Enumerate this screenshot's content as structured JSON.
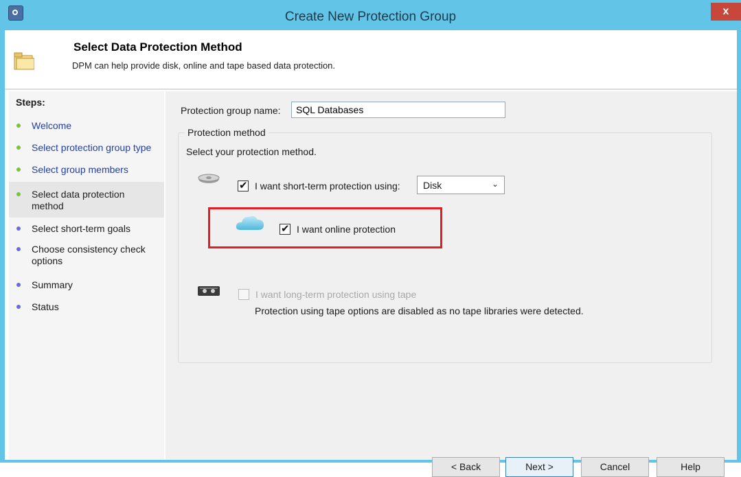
{
  "window": {
    "title": "Create New Protection Group",
    "close_label": "x"
  },
  "header": {
    "title": "Select Data Protection Method",
    "subtitle": "DPM can help provide disk, online and tape based data protection."
  },
  "steps": {
    "title": "Steps:",
    "items": [
      {
        "label": "Welcome",
        "state": "done"
      },
      {
        "label": "Select protection group type",
        "state": "done"
      },
      {
        "label": "Select group members",
        "state": "done"
      },
      {
        "label": "Select data protection method",
        "state": "current"
      },
      {
        "label": "Select short-term goals",
        "state": "todo"
      },
      {
        "label": "Choose consistency check options",
        "state": "todo"
      },
      {
        "label": "Summary",
        "state": "todo"
      },
      {
        "label": "Status",
        "state": "todo"
      }
    ]
  },
  "form": {
    "group_name_label": "Protection group name:",
    "group_name_value": "SQL Databases",
    "method_group_title": "Protection method",
    "method_prompt": "Select your protection method.",
    "short_term": {
      "label": "I want short-term protection using:",
      "checked": true,
      "selected": "Disk"
    },
    "online": {
      "label": "I want online protection",
      "checked": true
    },
    "tape": {
      "label": "I want long-term protection using tape",
      "checked": false,
      "disabled": true,
      "note": "Protection using tape options are disabled as no tape libraries were detected."
    }
  },
  "buttons": {
    "back": "< Back",
    "next": "Next >",
    "cancel": "Cancel",
    "help": "Help"
  },
  "colors": {
    "titlebar": "#62c5e8",
    "highlight": "#e21d24",
    "done_dot": "#7fbf3f",
    "todo_dot": "#6b6bd6",
    "done_text": "#1f3fa6"
  }
}
